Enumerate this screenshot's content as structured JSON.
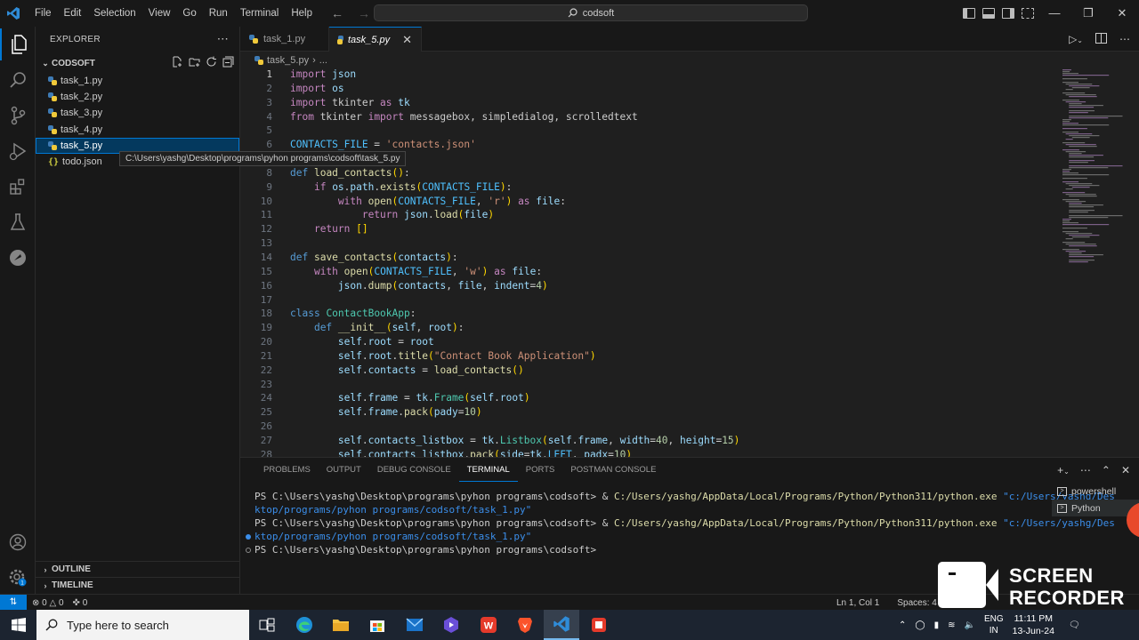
{
  "menu": [
    "File",
    "Edit",
    "Selection",
    "View",
    "Go",
    "Run",
    "Terminal",
    "Help"
  ],
  "search": {
    "text": "codsoft"
  },
  "sidebar": {
    "title": "EXPLORER",
    "folder": "CODSOFT",
    "files": [
      {
        "name": "task_1.py",
        "type": "py"
      },
      {
        "name": "task_2.py",
        "type": "py"
      },
      {
        "name": "task_3.py",
        "type": "py"
      },
      {
        "name": "task_4.py",
        "type": "py"
      },
      {
        "name": "task_5.py",
        "type": "py"
      },
      {
        "name": "todo.json",
        "type": "json"
      }
    ],
    "tooltip": "C:\\Users\\yashg\\Desktop\\programs\\pyhon programs\\codsoft\\task_5.py",
    "outline": "OUTLINE",
    "timeline": "TIMELINE"
  },
  "tabs": [
    {
      "label": "task_1.py",
      "active": false
    },
    {
      "label": "task_5.py",
      "active": true
    }
  ],
  "breadcrumb": {
    "file": "task_5.py",
    "more": "..."
  },
  "editor": {
    "current_line": 1,
    "lines": [
      "import json",
      "import os",
      "import tkinter as tk",
      "from tkinter import messagebox, simpledialog, scrolledtext",
      "",
      "CONTACTS_FILE = 'contacts.json'",
      "",
      "def load_contacts():",
      "    if os.path.exists(CONTACTS_FILE):",
      "        with open(CONTACTS_FILE, 'r') as file:",
      "            return json.load(file)",
      "    return []",
      "",
      "def save_contacts(contacts):",
      "    with open(CONTACTS_FILE, 'w') as file:",
      "        json.dump(contacts, file, indent=4)",
      "",
      "class ContactBookApp:",
      "    def __init__(self, root):",
      "        self.root = root",
      "        self.root.title(\"Contact Book Application\")",
      "        self.contacts = load_contacts()",
      "",
      "        self.frame = tk.Frame(self.root)",
      "        self.frame.pack(pady=10)",
      "",
      "        self.contacts_listbox = tk.Listbox(self.frame, width=40, height=15)",
      "        self.contacts_listbox.pack(side=tk.LEFT, padx=10)"
    ]
  },
  "panel": {
    "tabs": [
      "PROBLEMS",
      "OUTPUT",
      "DEBUG CONSOLE",
      "TERMINAL",
      "PORTS",
      "POSTMAN CONSOLE"
    ],
    "active_tab": "TERMINAL",
    "terminal": [
      {
        "prompt": "PS C:\\Users\\yashg\\Desktop\\programs\\pyhon programs\\codsoft> & ",
        "exe": "C:/Users/yashg/AppData/Local/Programs/Python/Python311/python.exe",
        "arg": " \"c:/Users/yashg/Des"
      },
      {
        "cont": "ktop/programs/pyhon programs/codsoft/task_1.py\""
      },
      {
        "prompt": "PS C:\\Users\\yashg\\Desktop\\programs\\pyhon programs\\codsoft> & ",
        "exe": "C:/Users/yashg/AppData/Local/Programs/Python/Python311/python.exe",
        "arg": " \"c:/Users/yashg/Des"
      },
      {
        "cont": "ktop/programs/pyhon programs/codsoft/task_1.py\""
      },
      {
        "prompt": "PS C:\\Users\\yashg\\Desktop\\programs\\pyhon programs\\codsoft> "
      }
    ],
    "terminals": [
      "powershell",
      "Python"
    ]
  },
  "statusbar": {
    "errors": "0",
    "warnings": "0",
    "ports": "0",
    "position": "Ln 1, Col 1",
    "spaces": "Spaces: 4"
  },
  "recorder": {
    "line1": "SCREEN",
    "line2": "RECORDER"
  },
  "taskbar": {
    "search_placeholder": "Type here to search",
    "lang1": "ENG",
    "lang2": "IN",
    "time": "11:11 PM",
    "date": "13-Jun-24"
  },
  "colors": {
    "accent": "#0078d4",
    "editor_bg": "#1f1f1f",
    "chrome_bg": "#181818"
  }
}
